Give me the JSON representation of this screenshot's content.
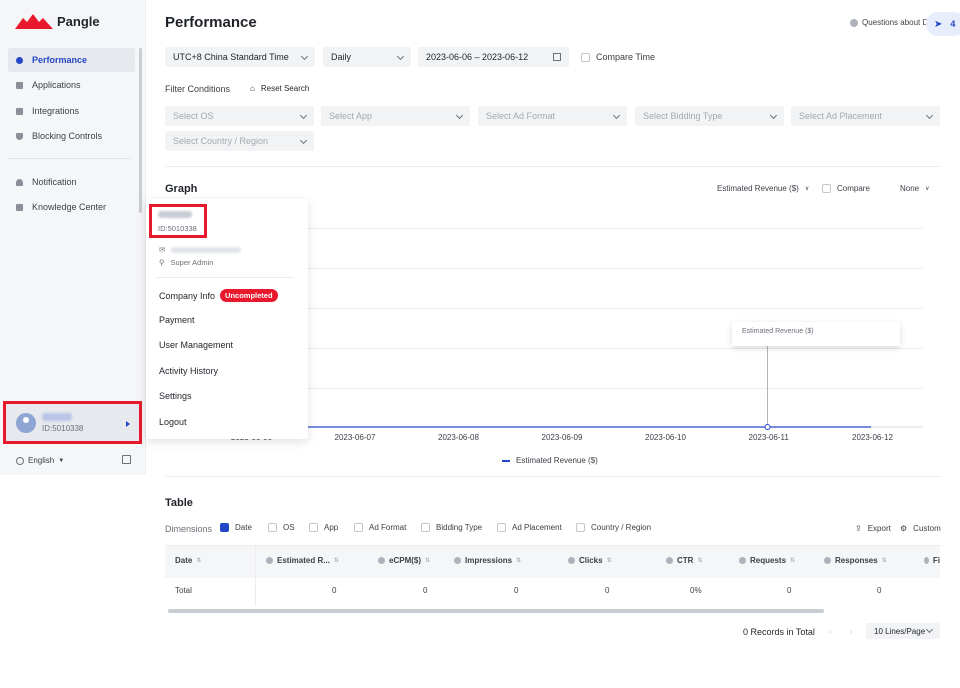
{
  "sidebar": {
    "brand": "Pangle",
    "items": [
      {
        "label": "Performance",
        "icon": "pie-chart-icon"
      },
      {
        "label": "Applications",
        "icon": "app-icon"
      },
      {
        "label": "Integrations",
        "icon": "integration-icon"
      },
      {
        "label": "Blocking Controls",
        "icon": "shield-icon"
      },
      {
        "label": "Notification",
        "icon": "bell-icon"
      },
      {
        "label": "Knowledge Center",
        "icon": "book-icon"
      }
    ],
    "user_id": "ID:5010338",
    "language": "English"
  },
  "header": {
    "title": "Performance",
    "help": "Questions about D",
    "fab_count": "4"
  },
  "filters": {
    "timezone": "UTC+8 China Standard Time",
    "granularity": "Daily",
    "date_range": "2023-06-06 – 2023-06-12",
    "compare_time": "Compare Time",
    "filter_conditions": "Filter Conditions",
    "reset_search": "Reset Search",
    "os": "Select OS",
    "app": "Select App",
    "ad_format": "Select Ad Format",
    "bidding_type": "Select Bidding Type",
    "ad_placement": "Select Ad Placement",
    "country": "Select Country / Region"
  },
  "graph": {
    "title": "Graph",
    "metric": "Estimated Revenue ($)",
    "compare": "Compare",
    "none": "None",
    "tooltip": "Estimated Revenue ($)",
    "legend": "Estimated Revenue ($)",
    "x_ticks": [
      "2023-06-06",
      "2023-06-07",
      "2023-06-08",
      "2023-06-09",
      "2023-06-10",
      "2023-06-11",
      "2023-06-12"
    ]
  },
  "chart_data": {
    "type": "line",
    "x": [
      "2023-06-06",
      "2023-06-07",
      "2023-06-08",
      "2023-06-09",
      "2023-06-10",
      "2023-06-11",
      "2023-06-12"
    ],
    "series": [
      {
        "name": "Estimated Revenue ($)",
        "values": [
          0,
          0,
          0,
          0,
          0,
          0,
          0
        ]
      }
    ],
    "grid": true,
    "legend": "bottom-center"
  },
  "dropdown": {
    "user_id": "ID:5010338",
    "role": "Super Admin",
    "company_info": "Company Info",
    "uncompleted": "Uncompleted",
    "payment": "Payment",
    "user_management": "User Management",
    "activity_history": "Activity History",
    "settings": "Settings",
    "logout": "Logout"
  },
  "table": {
    "title": "Table",
    "dimensions_label": "Dimensions",
    "dimensions": [
      {
        "label": "Date",
        "checked": true
      },
      {
        "label": "OS",
        "checked": false
      },
      {
        "label": "App",
        "checked": false
      },
      {
        "label": "Ad Format",
        "checked": false
      },
      {
        "label": "Bidding Type",
        "checked": false
      },
      {
        "label": "Ad Placement",
        "checked": false
      },
      {
        "label": "Country / Region",
        "checked": false
      }
    ],
    "export": "Export",
    "custom": "Custom",
    "columns": [
      "Date",
      "Estimated R...",
      "eCPM($)",
      "Impressions",
      "Clicks",
      "CTR",
      "Requests",
      "Responses",
      "Fi"
    ],
    "total_row": [
      "Total",
      "0",
      "0",
      "0",
      "0",
      "0%",
      "0",
      "0"
    ],
    "records": "0 Records in Total",
    "page_size": "10 Lines/Page"
  }
}
